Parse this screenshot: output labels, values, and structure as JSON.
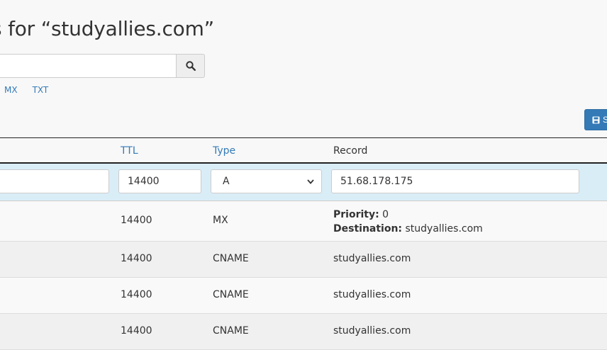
{
  "title": "s for “studyallies.com”",
  "search": {
    "placeholder": "",
    "value": ""
  },
  "filters": [
    "MX",
    "TXT"
  ],
  "save_label": "S",
  "table": {
    "headers": {
      "ttl": "TTL",
      "type": "Type",
      "record": "Record"
    },
    "edit_row": {
      "name": "",
      "ttl": "14400",
      "type": "A",
      "record": "51.68.178.175"
    },
    "rows": [
      {
        "ttl": "14400",
        "type": "MX",
        "priority_label": "Priority:",
        "priority": "0",
        "destination_label": "Destination:",
        "destination": "studyallies.com"
      },
      {
        "ttl": "14400",
        "type": "CNAME",
        "record": "studyallies.com"
      },
      {
        "ttl": "14400",
        "type": "CNAME",
        "record": "studyallies.com"
      },
      {
        "ttl": "14400",
        "type": "CNAME",
        "record": "studyallies.com"
      }
    ]
  },
  "colors": {
    "link": "#337ab7",
    "edit_row_bg": "#d9edf7",
    "primary_button": "#337ab7"
  }
}
